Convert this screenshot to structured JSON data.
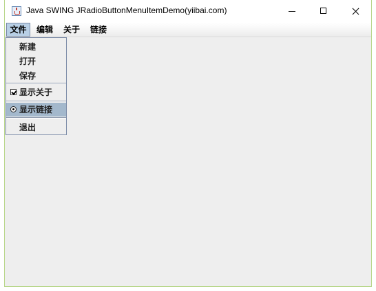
{
  "window": {
    "title": "Java SWING JRadioButtonMenuItemDemo(yiibai.com)"
  },
  "icons": {
    "app": "java-cup-icon",
    "minimize": "minimize-icon",
    "maximize": "maximize-icon",
    "close": "close-icon"
  },
  "menubar": {
    "items": [
      "文件",
      "编辑",
      "关于",
      "链接"
    ],
    "active": "文件"
  },
  "file_menu": {
    "new": "新建",
    "open": "打开",
    "save": "保存",
    "show_about": "显示关于",
    "show_about_checked": true,
    "show_links": "显示链接",
    "show_links_selected": true,
    "exit": "退出"
  },
  "colors": {
    "highlight": "#a3b8cc",
    "menu_active": "#b8cfe5",
    "frame_border": "#b8d68a"
  }
}
